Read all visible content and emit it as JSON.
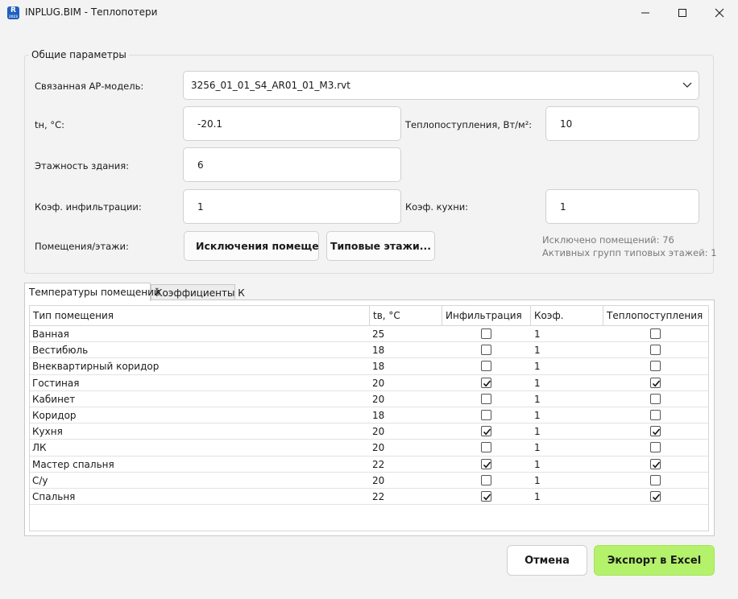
{
  "window": {
    "title": "INPLUG.BIM - Теплопотери",
    "icon_letter": "R",
    "icon_sub": "2023"
  },
  "colors": {
    "accent": "#b5f26b",
    "background": "#f3f3f3",
    "info_text": "#7a7a7a"
  },
  "general": {
    "title": "Общие параметры",
    "linked_model_label": "Связанная АР-модель:",
    "linked_model_value": "3256_01_01_S4_AR01_01_M3.rvt",
    "tn_label": "tн, °С:",
    "tn_value": "-20.1",
    "heat_gain_label": "Теплопоступления, Вт/м²:",
    "heat_gain_value": "10",
    "floors_label": "Этажность здания:",
    "floors_value": "6",
    "infil_label": "Коэф. инфильтрации:",
    "infil_value": "1",
    "kitchen_label": "Коэф. кухни:",
    "kitchen_value": "1",
    "rooms_label": "Помещения/этажи:",
    "exclusions_button": "Исключения помещений",
    "typical_floors_button": "Типовые этажи...",
    "excluded_info": "Исключено помещений: 76",
    "groups_info": "Активных групп типовых этажей: 1"
  },
  "tabs": [
    "Температуры помещений",
    "Коэффициенты К"
  ],
  "table": {
    "headers": [
      "Тип помещения",
      "tв, °С",
      "Инфильтрация",
      "Коэф.",
      "Теплопоступления"
    ],
    "rows": [
      {
        "type": "Ванная",
        "t": "25",
        "infil": false,
        "coef": "1",
        "heat": false
      },
      {
        "type": "Вестибюль",
        "t": "18",
        "infil": false,
        "coef": "1",
        "heat": false
      },
      {
        "type": "Внеквартирный коридор",
        "t": "18",
        "infil": false,
        "coef": "1",
        "heat": false
      },
      {
        "type": "Гостиная",
        "t": "20",
        "infil": true,
        "coef": "1",
        "heat": true
      },
      {
        "type": "Кабинет",
        "t": "20",
        "infil": false,
        "coef": "1",
        "heat": false
      },
      {
        "type": "Коридор",
        "t": "18",
        "infil": false,
        "coef": "1",
        "heat": false
      },
      {
        "type": "Кухня",
        "t": "20",
        "infil": true,
        "coef": "1",
        "heat": true
      },
      {
        "type": "ЛК",
        "t": "20",
        "infil": false,
        "coef": "1",
        "heat": false
      },
      {
        "type": "Мастер спальня",
        "t": "22",
        "infil": true,
        "coef": "1",
        "heat": true
      },
      {
        "type": "С/у",
        "t": "20",
        "infil": false,
        "coef": "1",
        "heat": false
      },
      {
        "type": "Спальня",
        "t": "22",
        "infil": true,
        "coef": "1",
        "heat": true
      }
    ]
  },
  "footer": {
    "cancel": "Отмена",
    "export": "Экспорт в Excel"
  }
}
